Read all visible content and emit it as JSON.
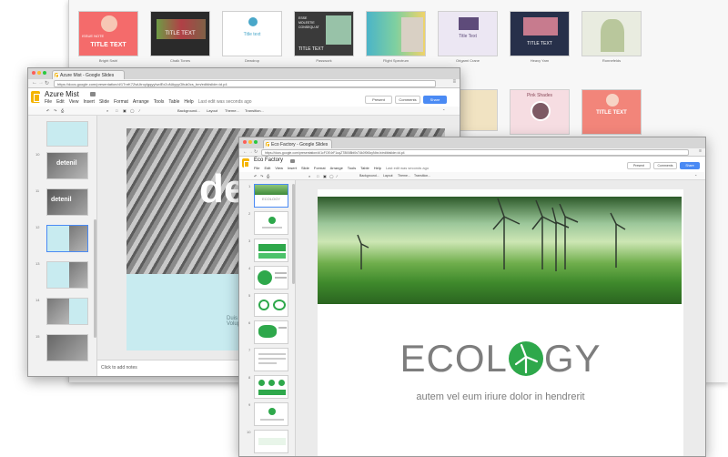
{
  "gallery": {
    "templates_row1": [
      "Bright Swirl",
      "Chalk Tones",
      "Dewdrop",
      "Passwork",
      "Flight Spectrum",
      "Origami Crane",
      "Heavy Yarn",
      "Ronnefelds"
    ],
    "thumb_texts": {
      "t1_title": "TITLE TEXT",
      "t1_badge": "ISSUE NOTE",
      "t2_title": "TITLE TEXT",
      "t3_title": "Title text",
      "t4_lines": "ESSE MOLESTIE CONSEQU AT",
      "t4_title": "TITLE TEXT",
      "t6_title": "Title Text",
      "t7_title": "TITLE TEXT",
      "r2_pink": "Pink Shades",
      "r2_title": "TITLE TEXT"
    }
  },
  "win1": {
    "tab_title": "Azure Mist - Google Slides",
    "url": "https://docs.google.com/presentation/d/1TnrK7ZwUtroyIgqyyIwdEx2uNAyyyGltuk0cs_bm/edit#slide=id.p4",
    "doc_title": "Azure Mist",
    "menu": [
      "File",
      "Edit",
      "View",
      "Insert",
      "Slide",
      "Format",
      "Arrange",
      "Tools",
      "Table",
      "Help"
    ],
    "last_edit": "Last edit was seconds ago",
    "present_label": "Present",
    "comments_label": "Comments",
    "share_label": "Share",
    "toolbar_items": [
      "Background...",
      "Layout",
      "Theme...",
      "Transition..."
    ],
    "slide_numbers": [
      "10",
      "11",
      "12",
      "13",
      "14",
      "15"
    ],
    "thumb_word": "detenil",
    "big_word": "de",
    "canvas_text": "Duis\nVolup",
    "notes_placeholder": "Click to add notes"
  },
  "win2": {
    "tab_title": "Eco Factory - Google Slides",
    "url": "https://docs.google.com/presentation/d/1cFOE4rF1uqZT8ll0l8bl0sT4k0f0t0cyNbx.b/edit#slide=id.p4",
    "doc_title": "Eco Factory",
    "menu": [
      "File",
      "Edit",
      "View",
      "Insert",
      "Slide",
      "Format",
      "Arrange",
      "Tools",
      "Table",
      "Help"
    ],
    "last_edit": "Last edit was seconds ago",
    "present_label": "Present",
    "comments_label": "Comments",
    "share_label": "Share",
    "toolbar_items": [
      "Background...",
      "Layout",
      "Theme...",
      "Transition..."
    ],
    "slide_numbers": [
      "1",
      "2",
      "3",
      "4",
      "5",
      "6",
      "7",
      "8",
      "9",
      "10"
    ],
    "thumb_word": "ECOLOGY",
    "slide_title_left": "ECOL",
    "slide_title_right": "GY",
    "slide_subtitle": "autem vel eum iriure dolor in hendrerit"
  },
  "colors": {
    "accent_green": "#2ea84b",
    "title_gray": "#7d7d7d",
    "share_blue": "#4a8af4",
    "slides_yellow": "#f4b400",
    "azure": "#c8ebf0"
  }
}
